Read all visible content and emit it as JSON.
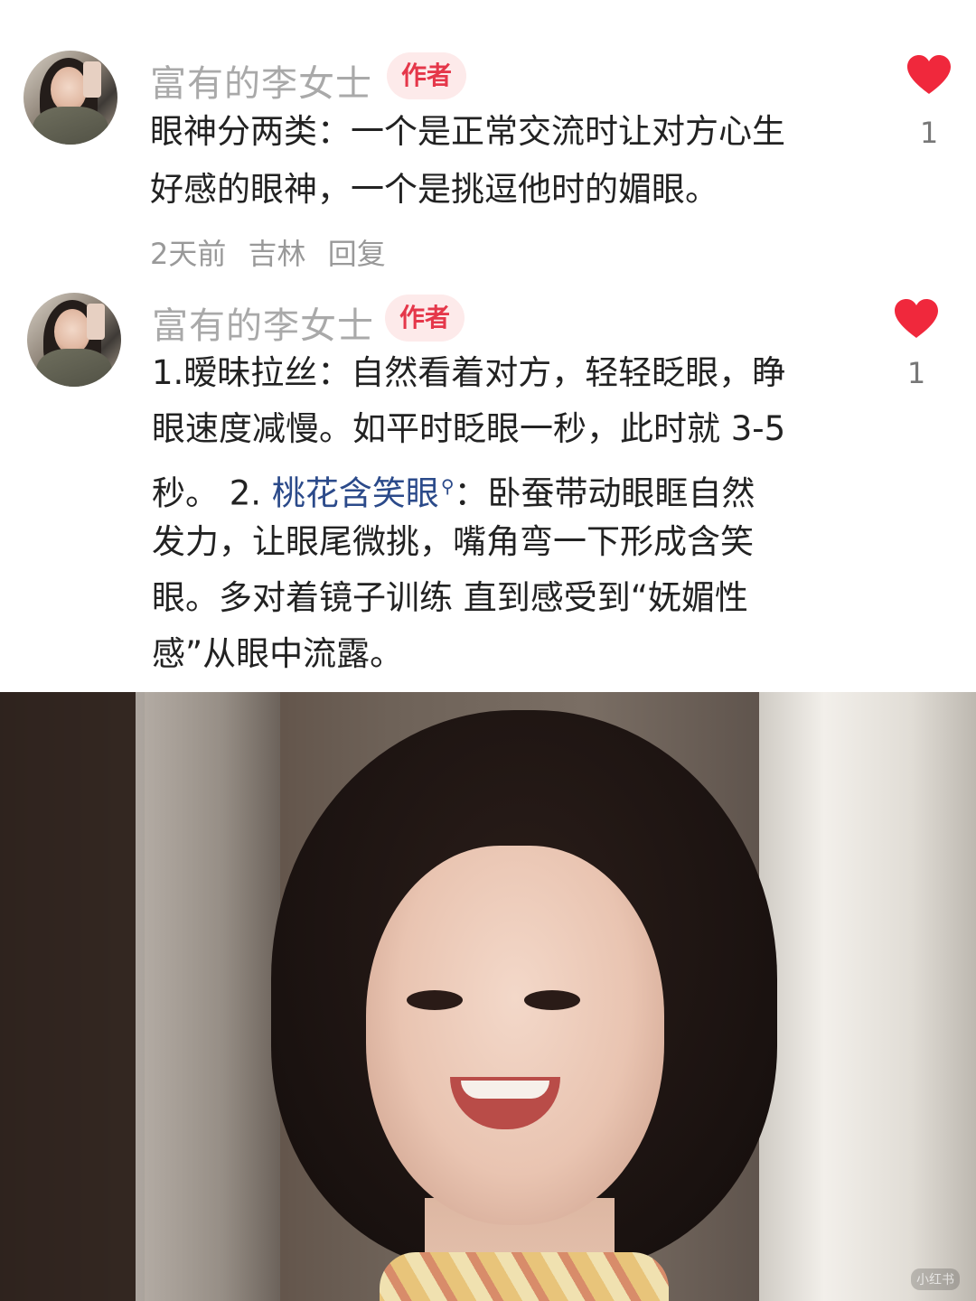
{
  "comments": [
    {
      "author": "富有的李女士",
      "badge": "作者",
      "lines": [
        "眼神分两类：一个是正常交流时让对方心生",
        "好感的眼神，一个是挑逗他时的媚眼。"
      ],
      "meta": {
        "time": "2天前",
        "location": "吉林",
        "reply": "回复"
      },
      "likes": "1"
    },
    {
      "author": "富有的李女士",
      "badge": "作者",
      "lines": [
        "1.暧昧拉丝：自然看着对方，轻轻眨眼，睁",
        "眼速度减慢。如平时眨眼一秒，此时就 3-5"
      ],
      "line3_before": "秒。 2. ",
      "line3_link": "桃花含笑眼",
      "line3_after": "：卧蚕带动眼眶自然",
      "lines_rest": [
        "发力，让眼尾微挑，嘴角弯一下形成含笑",
        "眼。多对着镜子训练 直到感受到“妩媚性",
        "感”从眼中流露。"
      ],
      "likes": "1"
    }
  ],
  "icons": {
    "like": "heart-icon",
    "search": "search-icon"
  },
  "colors": {
    "heart": "#f0283c",
    "badge_text": "#e5374a",
    "badge_bg": "#fdeaea",
    "link": "#2b4a8a"
  },
  "watermark": "小红书"
}
